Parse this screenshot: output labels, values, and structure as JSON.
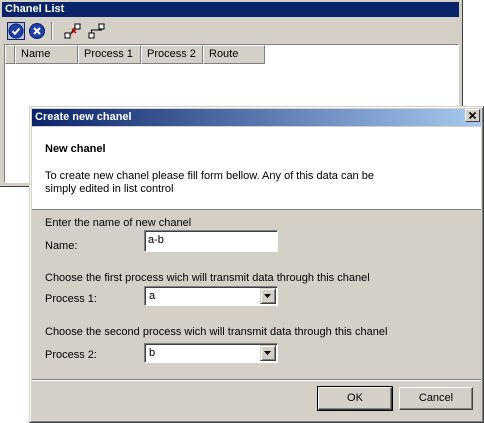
{
  "background_window": {
    "title": "Chanel List",
    "toolbar": {
      "icons": [
        "check-circle-icon",
        "close-circle-icon",
        "connect-nodes-icon",
        "route-nodes-icon"
      ]
    },
    "list": {
      "columns": [
        "Name",
        "Process 1",
        "Process 2",
        "Route"
      ]
    }
  },
  "dialog": {
    "title": "Create new chanel",
    "header": {
      "title": "New chanel",
      "description": "To create new chanel please fill form bellow. Any of this data can be simply edited in list control"
    },
    "name_section": {
      "instruction": "Enter the name of new chanel",
      "label": "Name:",
      "value": "a-b"
    },
    "process1_section": {
      "instruction": "Choose the first process wich will transmit data through this chanel",
      "label": "Process 1:",
      "value": "a"
    },
    "process2_section": {
      "instruction": "Choose the second process wich will transmit data through this chanel",
      "label": "Process 2:",
      "value": "b"
    },
    "buttons": {
      "ok": "OK",
      "cancel": "Cancel"
    }
  },
  "colors": {
    "titlebar": "#0a246a",
    "face": "#d4d0c8"
  }
}
